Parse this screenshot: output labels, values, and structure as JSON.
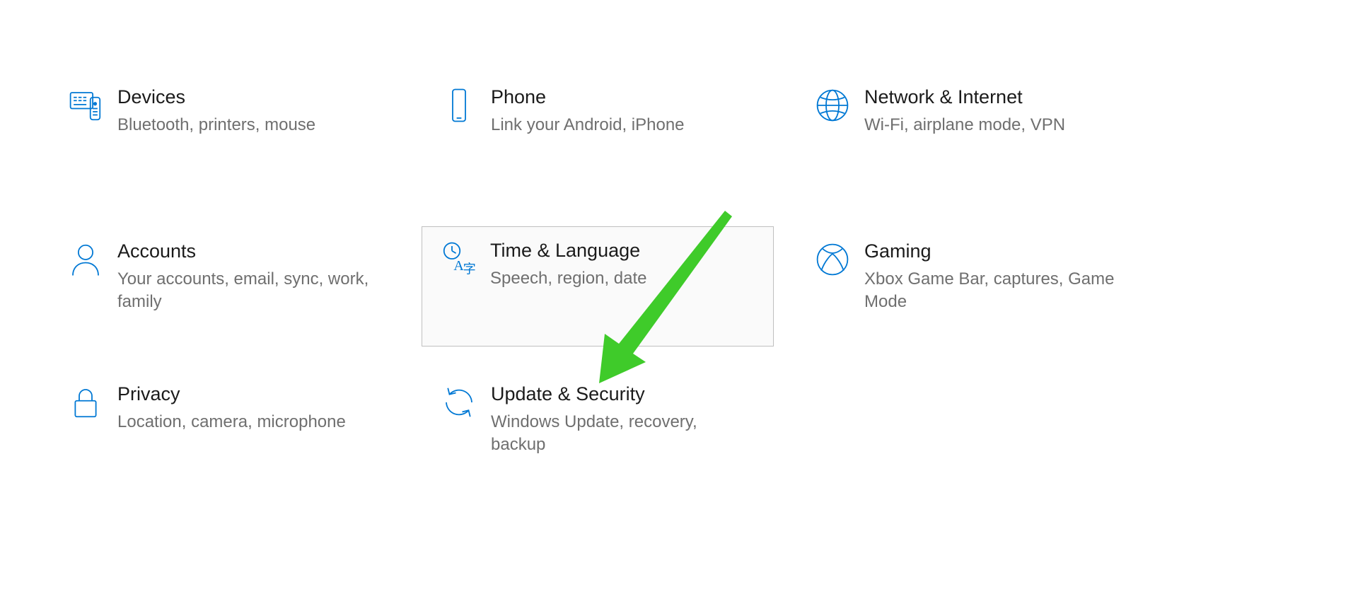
{
  "colors": {
    "accent": "#0078d4",
    "arrow": "#3fcb2a"
  },
  "tiles": [
    {
      "id": "devices",
      "title": "Devices",
      "desc": "Bluetooth, printers, mouse"
    },
    {
      "id": "phone",
      "title": "Phone",
      "desc": "Link your Android, iPhone"
    },
    {
      "id": "network",
      "title": "Network & Internet",
      "desc": "Wi-Fi, airplane mode, VPN"
    },
    {
      "id": "accounts",
      "title": "Accounts",
      "desc": "Your accounts, email, sync, work, family"
    },
    {
      "id": "time",
      "title": "Time & Language",
      "desc": "Speech, region, date"
    },
    {
      "id": "gaming",
      "title": "Gaming",
      "desc": "Xbox Game Bar, captures, Game Mode"
    },
    {
      "id": "privacy",
      "title": "Privacy",
      "desc": "Location, camera, microphone"
    },
    {
      "id": "update",
      "title": "Update & Security",
      "desc": "Windows Update, recovery, backup"
    }
  ]
}
